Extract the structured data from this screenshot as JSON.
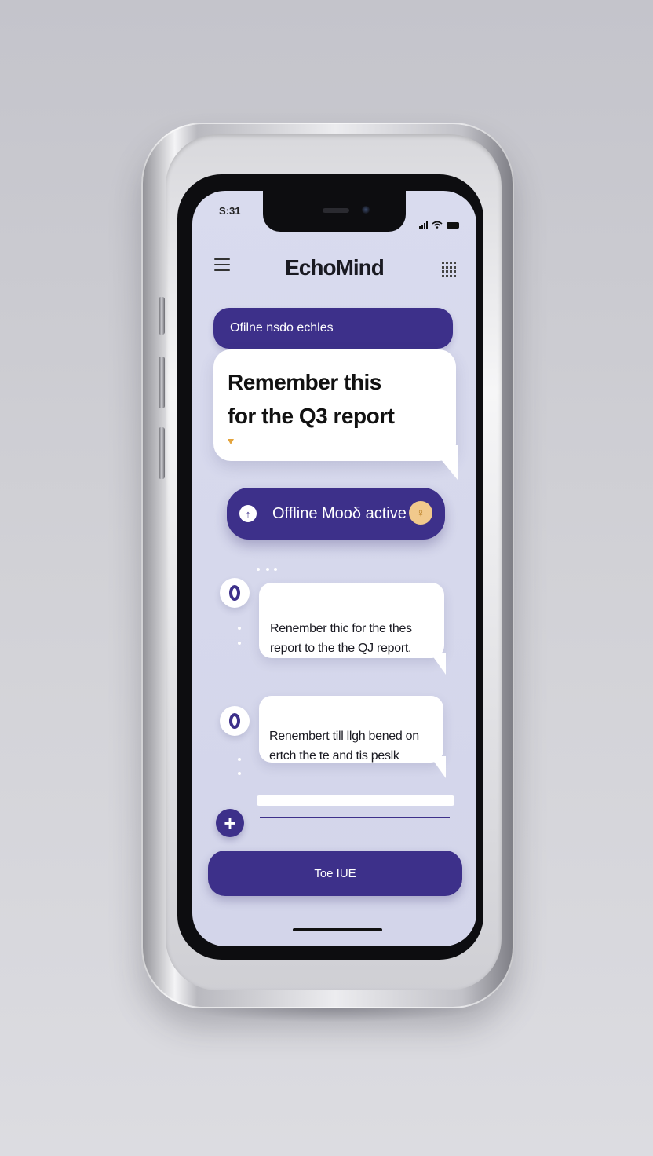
{
  "status_bar": {
    "time": "S:31"
  },
  "app": {
    "title": "EchoMind"
  },
  "banner": {
    "text": "Ofilne nsdo echles"
  },
  "hero_bubble": {
    "text": "Remember this\nfor the Q3 report"
  },
  "offline_pill": {
    "label": "Offline Mooδ active"
  },
  "messages": [
    {
      "text": "Renember thic for the thes\nreport to the the QJ report."
    },
    {
      "text": "Renembert till llgh bened on\nertch the te and tis peslk"
    }
  ],
  "main_button": {
    "label": "Toe IUE"
  },
  "icons": {
    "menu": "hamburger-menu-icon",
    "grid": "grid-icon",
    "signal": "signal-icon",
    "wifi": "wifi-icon",
    "battery": "battery-icon",
    "add": "plus-icon"
  },
  "colors": {
    "accent": "#3d308a",
    "screen_background": "#d9dbee",
    "highlight": "#f1c98c"
  }
}
